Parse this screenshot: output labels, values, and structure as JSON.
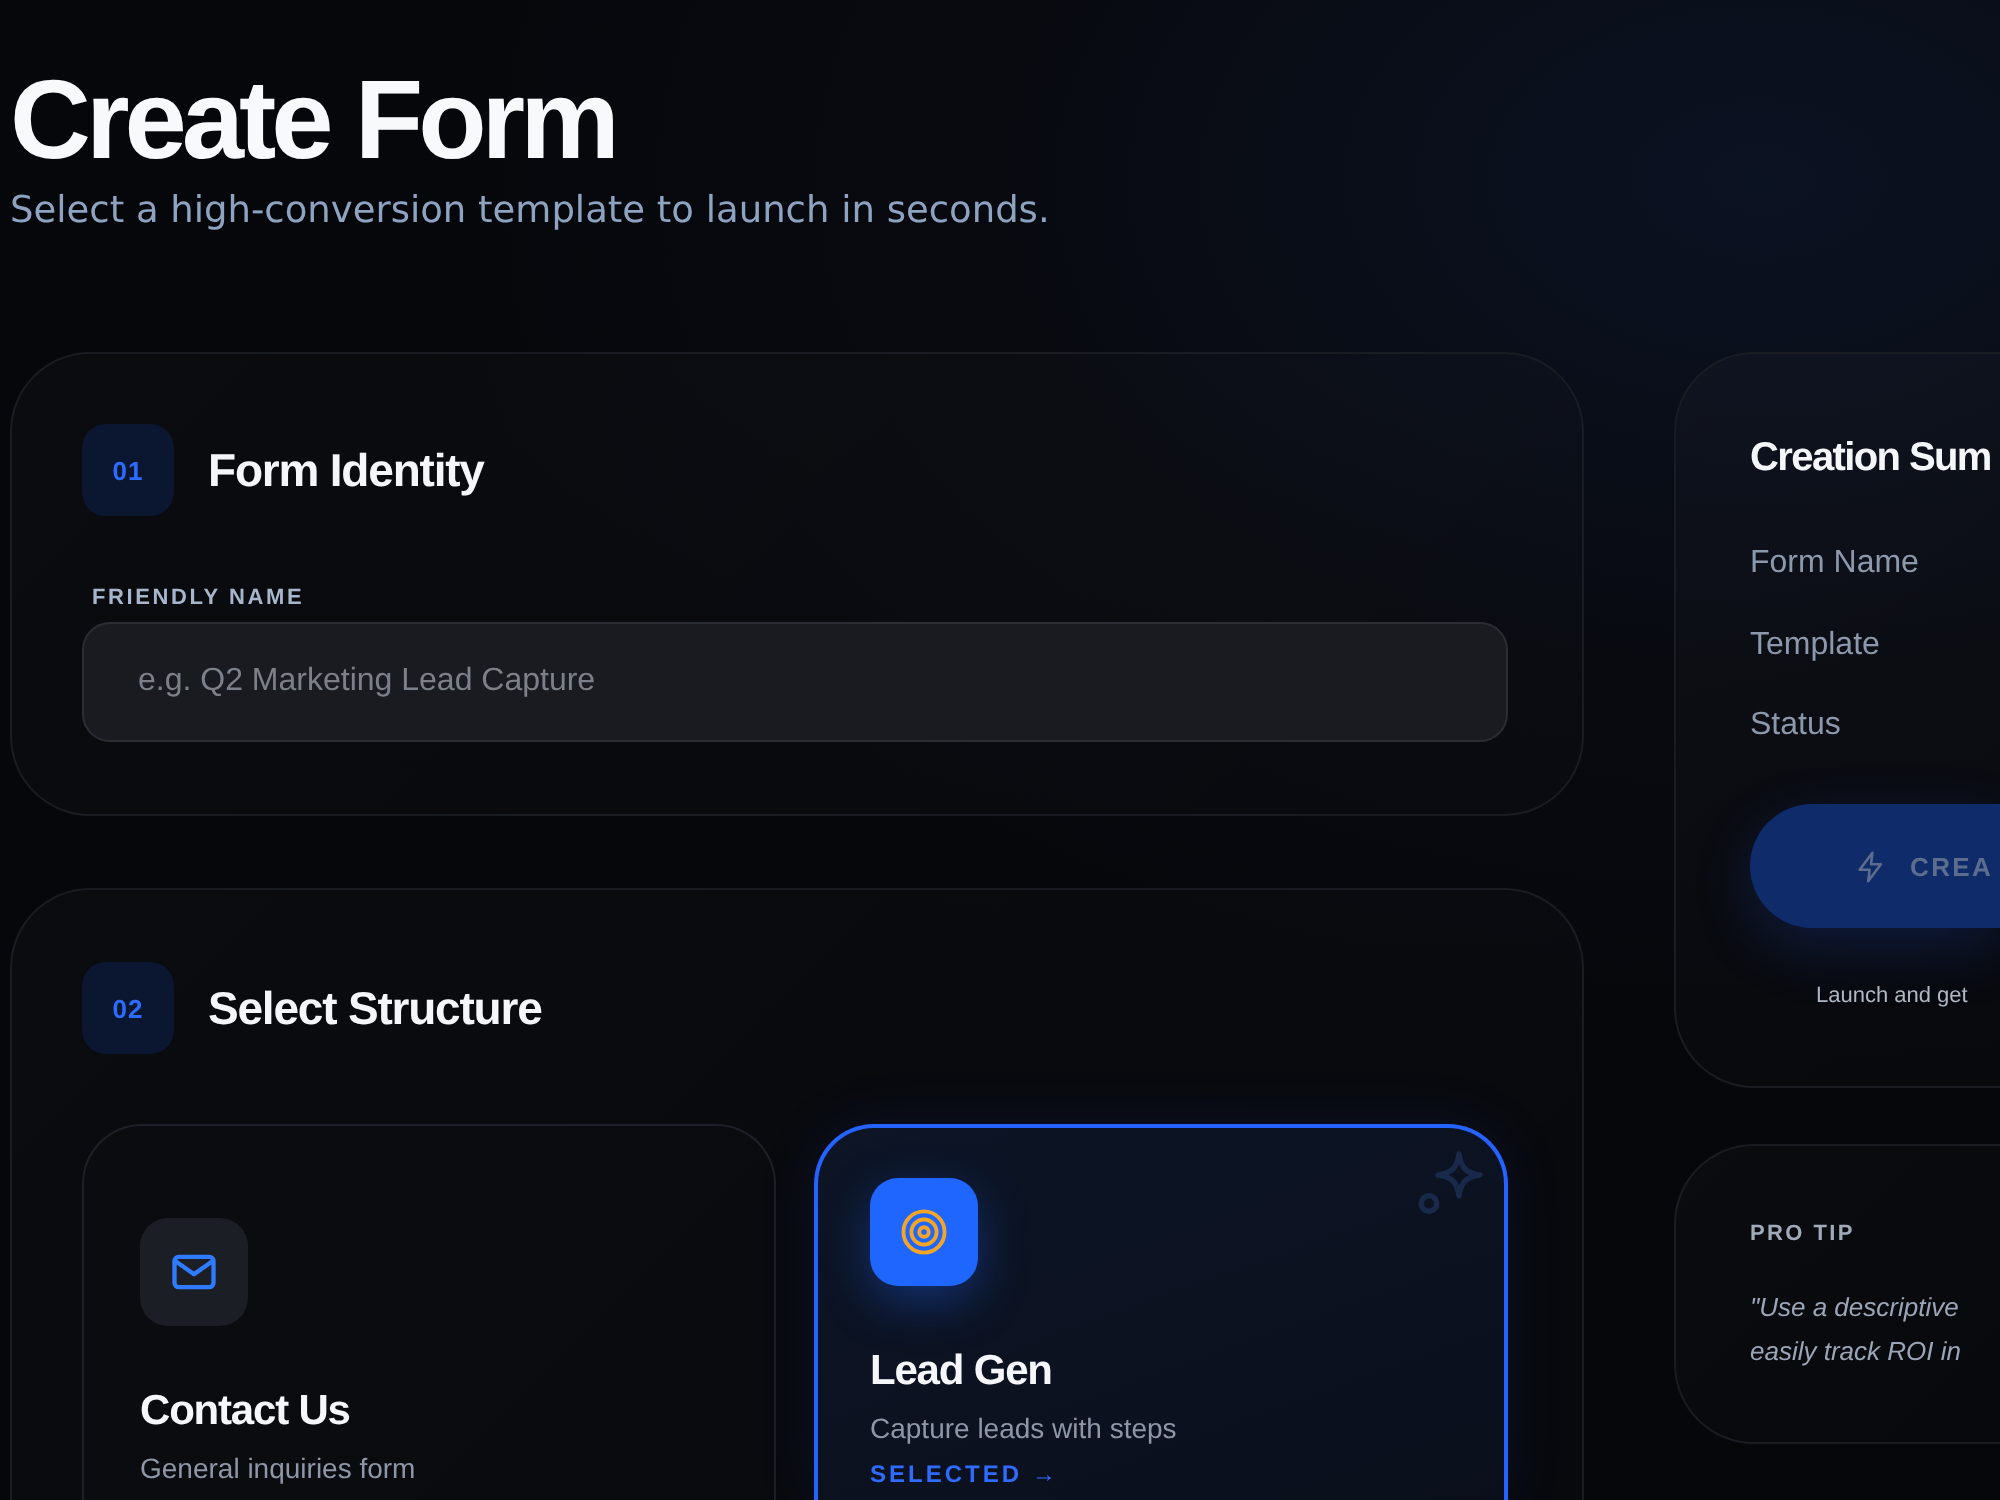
{
  "header": {
    "title": "Create Form",
    "subtitle": "Select a high-conversion template to launch in seconds."
  },
  "sections": [
    {
      "kind": "field",
      "number": "01",
      "title": "Form Identity",
      "field": {
        "label": "FRIENDLY NAME",
        "placeholder": "e.g. Q2 Marketing Lead Capture"
      }
    },
    {
      "kind": "templates",
      "number": "02",
      "title": "Select Structure",
      "selected_label": "SELECTED →",
      "templates": [
        {
          "name": "Contact Us",
          "description": "General inquiries form",
          "selected": false
        },
        {
          "name": "Lead Gen",
          "description": "Capture leads with steps",
          "selected": true
        }
      ]
    }
  ],
  "summary": {
    "title": "Creation Sum",
    "rows": [
      "Form Name",
      "Template",
      "Status"
    ],
    "button": {
      "label": "CREA",
      "disabled": true
    },
    "caption": "Launch and get"
  },
  "tip": {
    "label": "PRO TIP",
    "quote_lines": [
      "\"Use a descriptive",
      "easily track ROI in"
    ]
  }
}
